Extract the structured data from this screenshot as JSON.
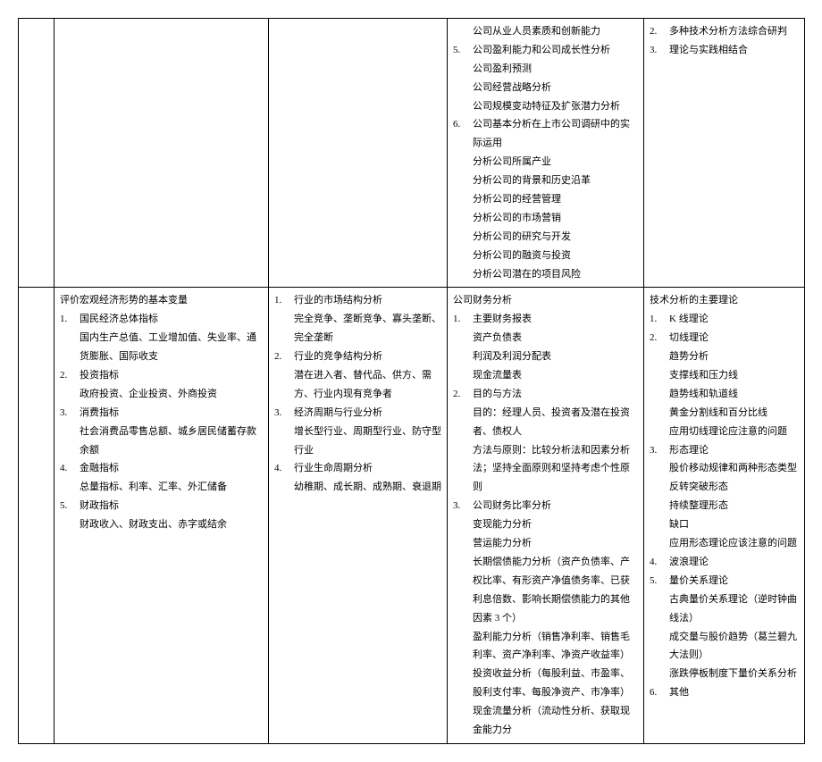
{
  "row1": {
    "col4": {
      "items": [
        {
          "no": "",
          "text": "公司从业人员素质和创新能力"
        },
        {
          "no": "5.",
          "text": "公司盈利能力和公司成长性分析"
        },
        {
          "sub": true,
          "text": "公司盈利预测"
        },
        {
          "sub": true,
          "text": "公司经营战略分析"
        },
        {
          "sub": true,
          "text": "公司规模变动特征及扩张潜力分析"
        },
        {
          "no": "6.",
          "text": "公司基本分析在上市公司调研中的实际运用"
        },
        {
          "sub": true,
          "text": "分析公司所属产业"
        },
        {
          "sub": true,
          "text": "分析公司的背景和历史沿革"
        },
        {
          "sub": true,
          "text": "分析公司的经营管理"
        },
        {
          "sub": true,
          "text": "分析公司的市场营销"
        },
        {
          "sub": true,
          "text": "分析公司的研究与开发"
        },
        {
          "sub": true,
          "text": "分析公司的融资与投资"
        },
        {
          "sub": true,
          "text": "分析公司潜在的项目风险"
        }
      ]
    },
    "col5": {
      "items": [
        {
          "no": "2.",
          "text": "多种技术分析方法综合研判"
        },
        {
          "no": "3.",
          "text": "理论与实践相结合"
        }
      ]
    }
  },
  "row2": {
    "col2": {
      "title": "评价宏观经济形势的基本变量",
      "items": [
        {
          "no": "1.",
          "text": "国民经济总体指标"
        },
        {
          "sub": true,
          "text": "国内生产总值、工业增加值、失业率、通货膨胀、国际收支"
        },
        {
          "no": "2.",
          "text": "投资指标"
        },
        {
          "sub": true,
          "text": "政府投资、企业投资、外商投资"
        },
        {
          "no": "3.",
          "text": "消费指标"
        },
        {
          "sub": true,
          "text": "社会消费品零售总额、城乡居民储蓄存款余额"
        },
        {
          "no": "4.",
          "text": "金融指标"
        },
        {
          "sub": true,
          "text": "总量指标、利率、汇率、外汇储备"
        },
        {
          "no": "5.",
          "text": "财政指标"
        },
        {
          "sub": true,
          "text": "财政收入、财政支出、赤字或结余"
        }
      ]
    },
    "col3": {
      "items": [
        {
          "no": "1.",
          "text": "行业的市场结构分析"
        },
        {
          "sub": true,
          "text": "完全竞争、垄断竞争、寡头垄断、完全垄断"
        },
        {
          "no": "2.",
          "text": "行业的竞争结构分析"
        },
        {
          "sub": true,
          "text": "潜在进入者、替代品、供方、需方、行业内现有竞争者"
        },
        {
          "no": "3.",
          "text": "经济周期与行业分析"
        },
        {
          "sub": true,
          "text": "增长型行业、周期型行业、防守型行业"
        },
        {
          "no": "4.",
          "text": "行业生命周期分析"
        },
        {
          "sub": true,
          "text": "幼稚期、成长期、成熟期、衰退期"
        }
      ]
    },
    "col4": {
      "title": "公司财务分析",
      "items": [
        {
          "no": "1.",
          "text": "主要财务报表"
        },
        {
          "sub": true,
          "text": "资产负债表"
        },
        {
          "sub": true,
          "text": "利润及利润分配表"
        },
        {
          "sub": true,
          "text": "现金流量表"
        },
        {
          "no": "2.",
          "text": "目的与方法"
        },
        {
          "sub": true,
          "text": "目的：经理人员、投资者及潜在投资者、债权人"
        },
        {
          "sub": true,
          "text": "方法与原则：比较分析法和因素分析法；坚持全面原则和坚持考虑个性原则"
        },
        {
          "no": "3.",
          "text": "公司财务比率分析"
        },
        {
          "sub": true,
          "text": "变现能力分析"
        },
        {
          "sub": true,
          "text": "营运能力分析"
        },
        {
          "sub": true,
          "text": "长期偿债能力分析（资产负债率、产权比率、有形资产净值债务率、已获利息倍数、影响长期偿债能力的其他因素 3 个）"
        },
        {
          "sub": true,
          "text": "盈利能力分析（销售净利率、销售毛利率、资产净利率、净资产收益率）"
        },
        {
          "sub": true,
          "text": "投资收益分析（每股利益、市盈率、股利支付率、每股净资产、市净率）"
        },
        {
          "sub": true,
          "text": "现金流量分析（流动性分析、获取现金能力分"
        }
      ]
    },
    "col5": {
      "title": "技术分析的主要理论",
      "items": [
        {
          "no": "1.",
          "text": "K 线理论"
        },
        {
          "no": "2.",
          "text": "切线理论"
        },
        {
          "sub": true,
          "text": "趋势分析"
        },
        {
          "sub": true,
          "text": "支撑线和压力线"
        },
        {
          "sub": true,
          "text": "趋势线和轨道线"
        },
        {
          "sub": true,
          "text": "黄金分割线和百分比线"
        },
        {
          "sub": true,
          "text": "应用切线理论应注意的问题"
        },
        {
          "no": "3.",
          "text": "形态理论"
        },
        {
          "sub": true,
          "text": "股价移动规律和两种形态类型"
        },
        {
          "sub": true,
          "text": "反转突破形态"
        },
        {
          "sub": true,
          "text": "持续整理形态"
        },
        {
          "sub": true,
          "text": "缺口"
        },
        {
          "sub": true,
          "text": "应用形态理论应该注意的问题"
        },
        {
          "no": "4.",
          "text": "波浪理论"
        },
        {
          "no": "5.",
          "text": "量价关系理论"
        },
        {
          "sub": true,
          "text": "古典量价关系理论（逆时钟曲线法）"
        },
        {
          "sub": true,
          "text": "成交量与股价趋势（葛兰碧九大法则）"
        },
        {
          "sub": true,
          "text": "涨跌停板制度下量价关系分析"
        },
        {
          "no": "6.",
          "text": "其他"
        }
      ]
    }
  }
}
